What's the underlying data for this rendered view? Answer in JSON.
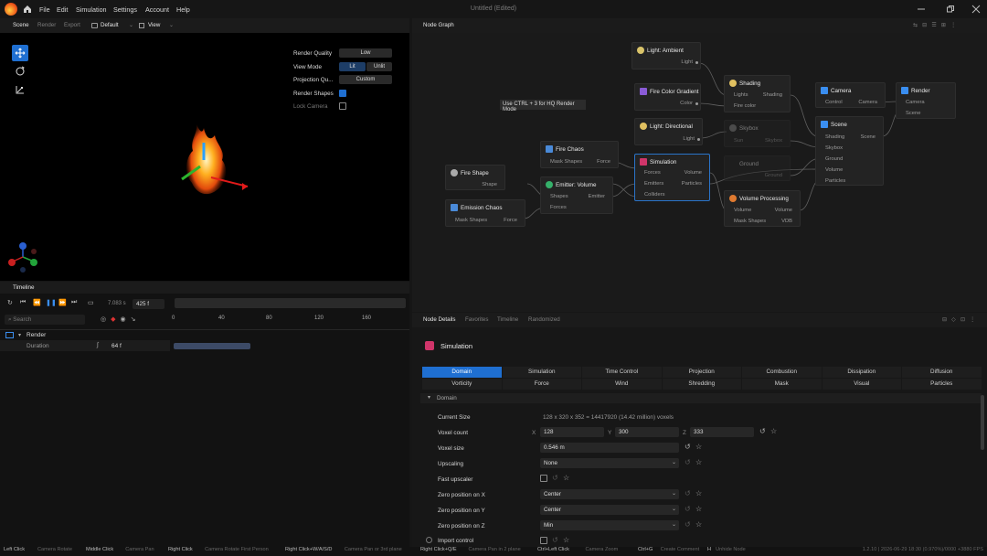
{
  "menubar": {
    "items": [
      "File",
      "Edit",
      "Simulation",
      "Settings",
      "Account",
      "Help"
    ],
    "window_title": "Untitled (Edited)"
  },
  "scene_panel": {
    "tabs": [
      "Scene",
      "Render",
      "Export"
    ],
    "camera": "Default",
    "view": "View",
    "props": {
      "render_quality": {
        "label": "Render Quality",
        "value": "Low"
      },
      "view_mode": {
        "label": "View Mode",
        "options": [
          "Lit",
          "Unlit"
        ]
      },
      "projection": {
        "label": "Projection Qu...",
        "value": "Custom"
      },
      "render_shapes": {
        "label": "Render Shapes",
        "checked": true
      },
      "lock_camera": {
        "label": "Lock Camera",
        "checked": false
      }
    }
  },
  "timeline": {
    "title": "Timeline",
    "time": "7.083 s",
    "frame": "425 f",
    "search_placeholder": "Search",
    "ruler": [
      "0",
      "40",
      "80",
      "120",
      "160"
    ],
    "tracks": {
      "render": "Render",
      "duration_label": "Duration",
      "duration_value": "64 f"
    }
  },
  "node_graph": {
    "title": "Node Graph",
    "tooltip": "Use CTRL + 3 for HQ Render Mode",
    "nodes": {
      "light_ambient": {
        "title": "Light: Ambient",
        "out": "Light"
      },
      "fire_gradient": {
        "title": "Fire Color Gradient",
        "out": "Color"
      },
      "light_directional": {
        "title": "Light: Directional",
        "out": "Light"
      },
      "shading": {
        "title": "Shading",
        "in1": "Lights",
        "out": "Shading",
        "in2": "Fire color"
      },
      "skybox": {
        "title": "Skybox",
        "in": "Sun",
        "out": "Skybox"
      },
      "ground": {
        "title": "Ground",
        "out": "Ground"
      },
      "fire_chaos": {
        "title": "Fire Chaos",
        "in": "Mask Shapes",
        "out": "Force"
      },
      "fire_shape": {
        "title": "Fire Shape",
        "out": "Shape"
      },
      "emission_chaos": {
        "title": "Emission Chaos",
        "in": "Mask Shapes",
        "out": "Force"
      },
      "emitter": {
        "title": "Emitter: Volume",
        "in1": "Shapes",
        "out": "Emitter",
        "in2": "Forces"
      },
      "simulation": {
        "title": "Simulation",
        "in1": "Forces",
        "out1": "Volume",
        "in2": "Emitters",
        "out2": "Particles",
        "in3": "Colliders"
      },
      "volume_processing": {
        "title": "Volume Processing",
        "in1": "Volume",
        "out1": "Volume",
        "in2": "Mask Shapes",
        "out2": "VDB"
      },
      "camera": {
        "title": "Camera",
        "in": "Control",
        "out": "Camera"
      },
      "scene": {
        "title": "Scene",
        "ports": [
          "Shading",
          "Skybox",
          "Ground",
          "Volume",
          "Particles"
        ],
        "out": "Scene"
      },
      "render": {
        "title": "Render",
        "ports": [
          "Camera",
          "Scene"
        ]
      }
    }
  },
  "details": {
    "tabs": [
      "Node Details",
      "Favorites",
      "Timeline",
      "Randomized"
    ],
    "node_title": "Simulation",
    "group_tabs_row1": [
      "Domain",
      "Simulation",
      "Time Control",
      "Projection",
      "Combustion",
      "Dissipation",
      "Diffusion"
    ],
    "group_tabs_row2": [
      "Vorticity",
      "Force",
      "Wind",
      "Shredding",
      "Mask",
      "Visual",
      "Particles"
    ],
    "section": "Domain",
    "rows": {
      "current_size": {
        "label": "Current Size",
        "value": "128 x 320 x 352 = 14417920 (14.42 million) voxels"
      },
      "voxel_count": {
        "label": "Voxel count",
        "x": "128",
        "y": "300",
        "z": "333"
      },
      "voxel_size": {
        "label": "Voxel size",
        "value": "0.546 m"
      },
      "upscaling": {
        "label": "Upscaling",
        "value": "None"
      },
      "fast_upscaler": {
        "label": "Fast upscaler"
      },
      "zero_x": {
        "label": "Zero position on X",
        "value": "Center"
      },
      "zero_y": {
        "label": "Zero position on Y",
        "value": "Center"
      },
      "zero_z": {
        "label": "Zero position on Z",
        "value": "Min"
      },
      "import_control": {
        "label": "Import control"
      }
    }
  },
  "statusbar": [
    {
      "k": "Left Click",
      "v": "Camera Rotate"
    },
    {
      "k": "Middle Click",
      "v": "Camera Pan"
    },
    {
      "k": "Right Click",
      "v": "Camera Rotate First Person"
    },
    {
      "k": "Right Click+W/A/S/D",
      "v": "Camera Pan or 3rd plane"
    },
    {
      "k": "Right Click+Q/E",
      "v": "Camera Pan in 2 plane"
    },
    {
      "k": "Ctrl+Left Click",
      "v": "Camera Zoom"
    },
    {
      "k": "Ctrl+G",
      "v": "Create Comment"
    },
    {
      "k": "H",
      "v": "Unhide Node"
    }
  ],
  "statusbar_right": "1.2.10  |  2026-06-29 18:30 (0.970%)/0000 +3880 FPS"
}
